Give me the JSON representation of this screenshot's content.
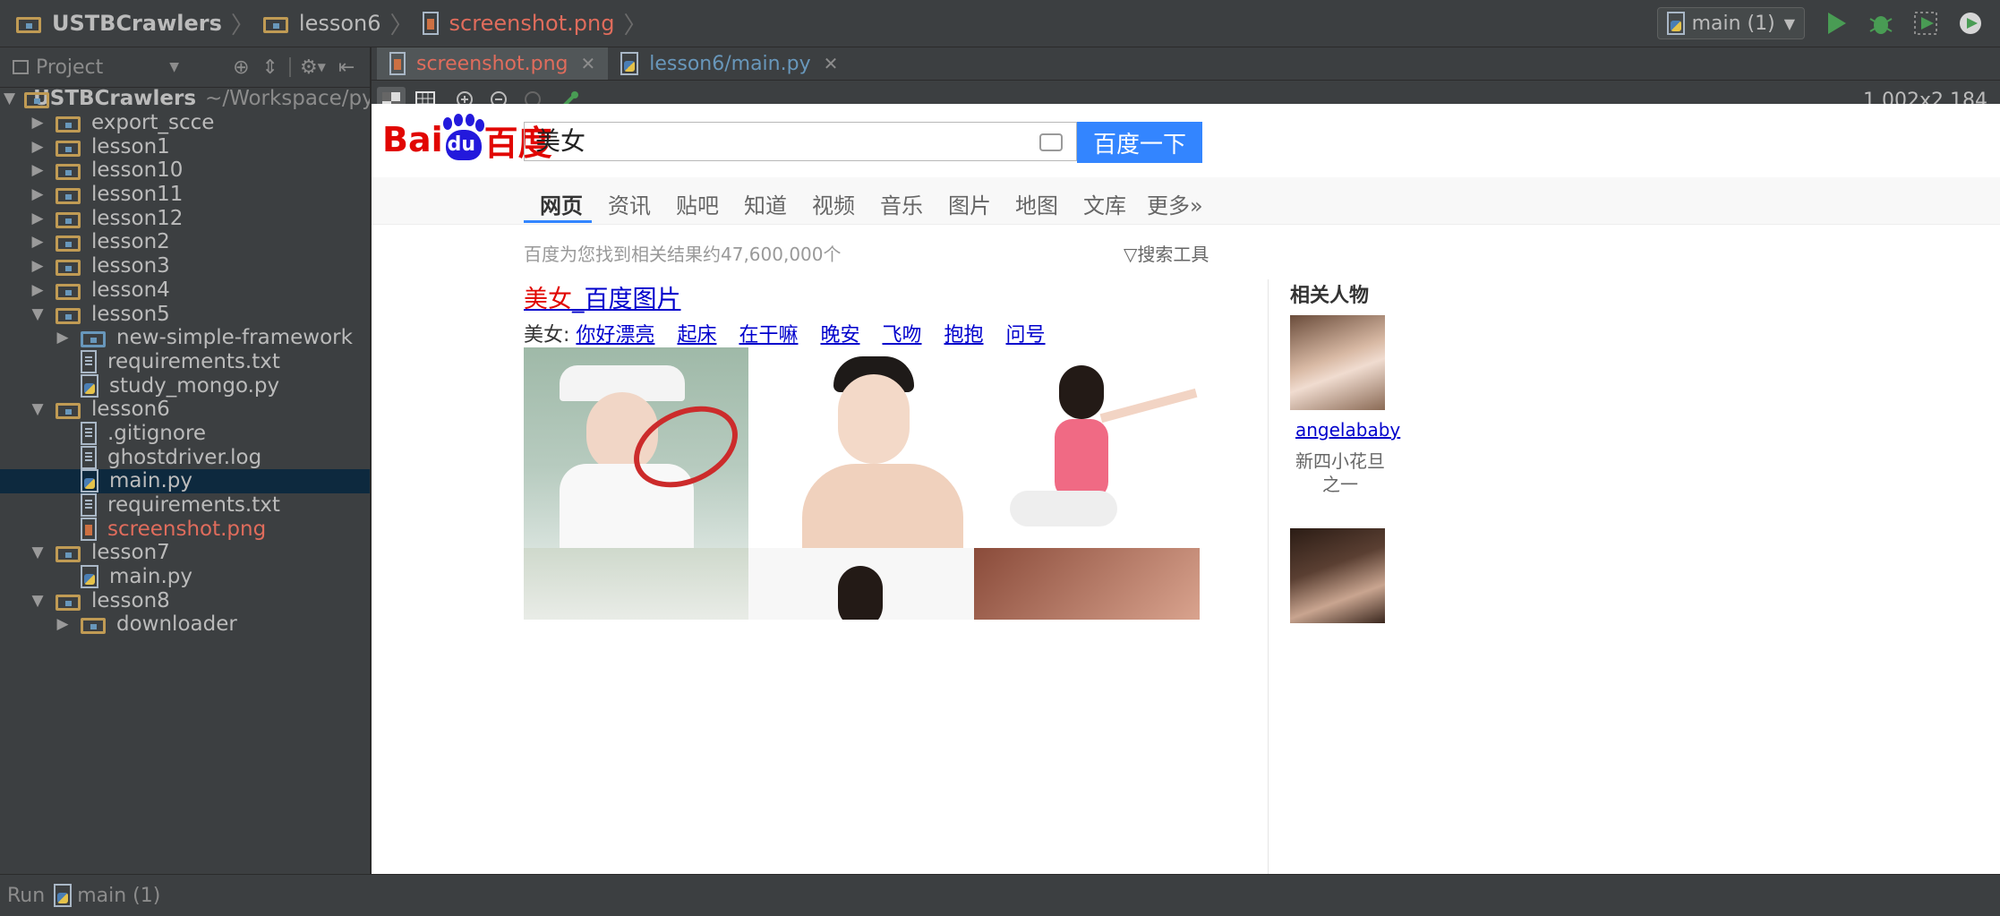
{
  "breadcrumb": {
    "items": [
      {
        "label": "USTBCrawlers"
      },
      {
        "label": "lesson6"
      },
      {
        "label": "screenshot.png"
      }
    ]
  },
  "run_toolbar": {
    "config_label": "main (1)"
  },
  "project_panel": {
    "title": "Project",
    "root_name": "USTBCrawlers",
    "root_path": "~/Workspace/python/USTBC",
    "tree": [
      {
        "label": "export_scce",
        "kind": "folder",
        "expanded": false,
        "depth": 1
      },
      {
        "label": "lesson1",
        "kind": "folder",
        "expanded": false,
        "depth": 1
      },
      {
        "label": "lesson10",
        "kind": "folder",
        "expanded": false,
        "depth": 1
      },
      {
        "label": "lesson11",
        "kind": "folder",
        "expanded": false,
        "depth": 1
      },
      {
        "label": "lesson12",
        "kind": "folder",
        "expanded": false,
        "depth": 1
      },
      {
        "label": "lesson2",
        "kind": "folder",
        "expanded": false,
        "depth": 1
      },
      {
        "label": "lesson3",
        "kind": "folder",
        "expanded": false,
        "depth": 1
      },
      {
        "label": "lesson4",
        "kind": "folder",
        "expanded": false,
        "depth": 1
      },
      {
        "label": "lesson5",
        "kind": "folder",
        "expanded": true,
        "depth": 1
      },
      {
        "label": "new-simple-framework",
        "kind": "folder-blue",
        "expanded": false,
        "depth": 2
      },
      {
        "label": "requirements.txt",
        "kind": "txt",
        "depth": 2
      },
      {
        "label": "study_mongo.py",
        "kind": "py",
        "depth": 2
      },
      {
        "label": "lesson6",
        "kind": "folder",
        "expanded": true,
        "depth": 1
      },
      {
        "label": ".gitignore",
        "kind": "txt",
        "depth": 2
      },
      {
        "label": "ghostdriver.log",
        "kind": "txt",
        "depth": 2
      },
      {
        "label": "main.py",
        "kind": "py",
        "depth": 2,
        "selected": true
      },
      {
        "label": "requirements.txt",
        "kind": "txt",
        "depth": 2
      },
      {
        "label": "screenshot.png",
        "kind": "png",
        "depth": 2,
        "highlight": true
      },
      {
        "label": "lesson7",
        "kind": "folder",
        "expanded": true,
        "depth": 1
      },
      {
        "label": "main.py",
        "kind": "py",
        "depth": 2
      },
      {
        "label": "lesson8",
        "kind": "folder",
        "expanded": true,
        "depth": 1
      },
      {
        "label": "downloader",
        "kind": "folder",
        "expanded": false,
        "depth": 2
      }
    ]
  },
  "editor_tabs": [
    {
      "label": "screenshot.png",
      "active": true
    },
    {
      "label": "lesson6/main.py",
      "active": false
    }
  ],
  "image_viewer": {
    "dimensions": "1,002x2,184"
  },
  "baidu": {
    "logo_text": "Bai",
    "logo_du": "du",
    "logo_cn": "百度",
    "query": "美女",
    "search_button": "百度一下",
    "nav": [
      "网页",
      "资讯",
      "贴吧",
      "知道",
      "视频",
      "音乐",
      "图片",
      "地图",
      "文库",
      "更多»"
    ],
    "result_count": "百度为您找到相关结果约47,600,000个",
    "search_tools": "搜索工具",
    "result_title_hl": "美女",
    "result_title_rest": "_百度图片",
    "links_prefix": "美女:",
    "links": [
      "你好漂亮",
      "起床",
      "在干嘛",
      "晚安",
      "飞吻",
      "抱抱",
      "问号"
    ],
    "related_title": "相关人物",
    "related_person_name": "angelababy",
    "related_person_desc": "新四小花旦之一"
  },
  "statusbar": {
    "run_label": "Run",
    "config": "main (1)"
  }
}
